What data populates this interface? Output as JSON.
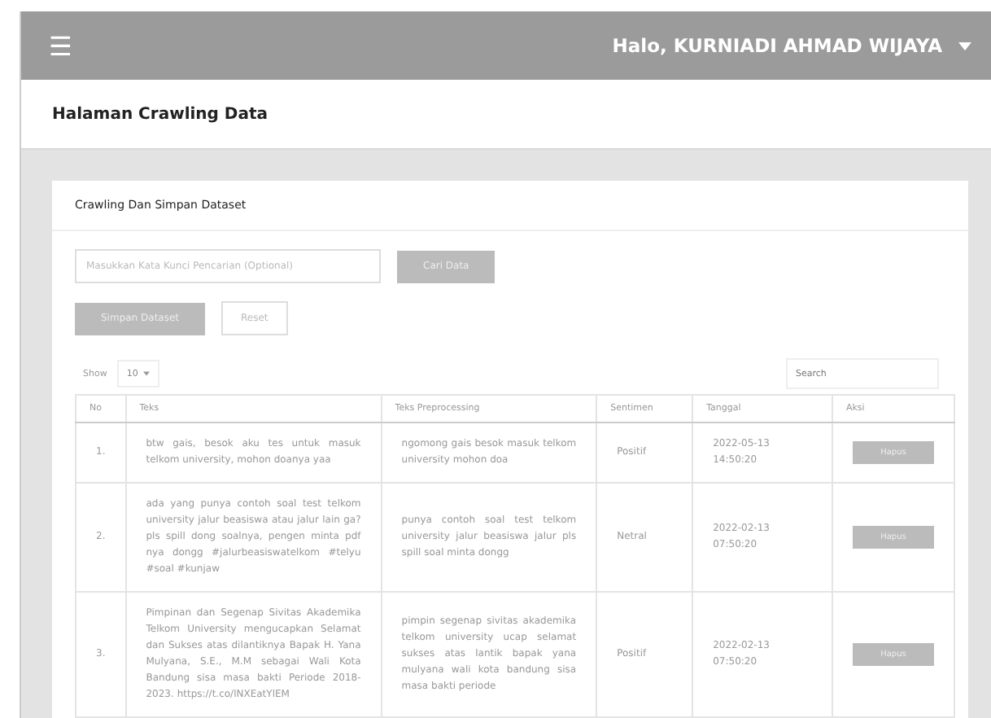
{
  "header": {
    "menu_icon": "☰",
    "user": "Halo, KURNIADI AHMAD WIJAYA"
  },
  "page_title": "Halaman Crawling Data",
  "card": {
    "title": "Crawling Dan Simpan Dataset",
    "search": {
      "placeholder": "Masukkan Kata Kunci Pencarian (Optional)"
    },
    "buttons": [
      {
        "label": "Cari Data",
        "kind": "filled"
      },
      {
        "label": "Simpan Dataset",
        "kind": "filled"
      },
      {
        "label": "Reset",
        "kind": "outline"
      }
    ],
    "show": {
      "label": "Show",
      "value": "10"
    },
    "table_search": {
      "placeholder": "Search"
    },
    "table": {
      "columns": [
        "No",
        "Teks",
        "Teks Preprocessing",
        "Sentimen",
        "Tanggal",
        "Aksi"
      ],
      "rows": [
        {
          "no": "1.",
          "teks": "btw gais, besok aku tes untuk masuk telkom university, mohon doanya yaa",
          "prep": "ngomong gais besok masuk telkom university mohon doa",
          "sentimen": "Positif",
          "tanggal": "2022-05-13 14:50:20",
          "action": "Hapus"
        },
        {
          "no": "2.",
          "teks": "ada yang punya contoh soal test telkom university jalur beasiswa atau jalur lain ga? pls spill dong soalnya, pengen minta pdf nya dongg #jalurbeasiswatelkom #telyu #soal #kunjaw",
          "prep": "punya contoh soal test telkom university jalur beasiswa jalur pls spill soal minta dongg",
          "sentimen": "Netral",
          "tanggal": "2022-02-13 07:50:20",
          "action": "Hapus"
        },
        {
          "no": "3.",
          "teks": "Pimpinan dan Segenap Sivitas Akademika Telkom University mengucapkan Selamat dan Sukses atas dilantiknya Bapak H. Yana Mulyana, S.E., M.M sebagai Wali Kota Bandung sisa masa bakti Periode 2018-2023. https://t.co/lNXEatYlEM",
          "prep": "pimpin segenap sivitas akademika telkom university ucap selamat sukses atas lantik bapak yana mulyana wali kota bandung sisa masa bakti periode",
          "sentimen": "Positif",
          "tanggal": "2022-02-13 07:50:20",
          "action": "Hapus"
        }
      ]
    }
  }
}
